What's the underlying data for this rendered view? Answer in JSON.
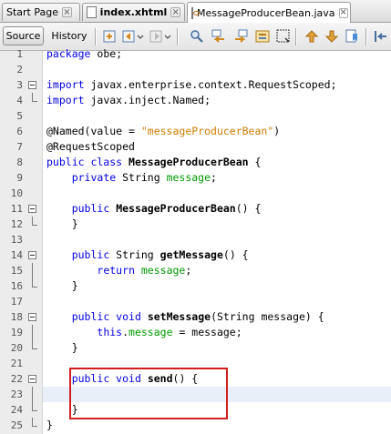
{
  "tabs": [
    {
      "label": "Start Page",
      "active": false,
      "bold": false
    },
    {
      "label": "index.xhtml",
      "active": false,
      "bold": true
    },
    {
      "label": "MessageProducerBean.java",
      "active": true,
      "bold": false
    }
  ],
  "toolbar": {
    "source_label": "Source",
    "history_label": "History",
    "icons": [
      "last-edit-icon",
      "back-icon",
      "forward-icon",
      "find-icon",
      "find-previous-icon",
      "find-next-icon",
      "find-selection-icon",
      "toggle-highlight-icon",
      "toggle-rect-select-icon",
      "previous-bookmark-icon",
      "next-bookmark-icon",
      "toggle-bookmark-icon",
      "shift-left-icon"
    ]
  },
  "editor": {
    "current_line": 23,
    "lines": [
      {
        "n": "1"
      },
      {
        "n": "2"
      },
      {
        "n": "3"
      },
      {
        "n": "4"
      },
      {
        "n": "5"
      },
      {
        "n": "6"
      },
      {
        "n": "7"
      },
      {
        "n": "8"
      },
      {
        "n": "9"
      },
      {
        "n": "10"
      },
      {
        "n": "11"
      },
      {
        "n": "12"
      },
      {
        "n": "13"
      },
      {
        "n": "14"
      },
      {
        "n": "15"
      },
      {
        "n": "16"
      },
      {
        "n": "17"
      },
      {
        "n": "18"
      },
      {
        "n": "19"
      },
      {
        "n": "20"
      },
      {
        "n": "21"
      },
      {
        "n": "22"
      },
      {
        "n": "23"
      },
      {
        "n": "24"
      },
      {
        "n": "25"
      }
    ],
    "code": {
      "l1_kw": "package",
      "l1_rest": " obe;",
      "l3_kw": "import",
      "l3_rest": " javax.enterprise.context.RequestScoped;",
      "l4_kw": "import",
      "l4_rest": " javax.inject.Named;",
      "l6_a": "@Named(value = ",
      "l6_str": "\"messageProducerBean\"",
      "l6_b": ")",
      "l7": "@RequestScoped",
      "l8_kw": "public class",
      "l8_sp": " ",
      "l8_name": "MessageProducerBean",
      "l8_rest": " {",
      "l9_ind": "    ",
      "l9_kw": "private",
      "l9_type": " String ",
      "l9_fld": "message",
      "l9_end": ";",
      "l11_ind": "    ",
      "l11_kw": "public",
      "l11_sp": " ",
      "l11_name": "MessageProducerBean",
      "l11_rest": "() {",
      "l12": "    }",
      "l14_ind": "    ",
      "l14_kw": "public",
      "l14_type": " String ",
      "l14_name": "getMessage",
      "l14_rest": "() {",
      "l15_ind": "        ",
      "l15_kw": "return",
      "l15_sp": " ",
      "l15_fld": "message",
      "l15_end": ";",
      "l16": "    }",
      "l18_ind": "    ",
      "l18_kw": "public void",
      "l18_sp": " ",
      "l18_name": "setMessage",
      "l18_rest": "(String message) {",
      "l19_ind": "        ",
      "l19_kw": "this",
      "l19_dot": ".",
      "l19_fld": "message",
      "l19_rest": " = message;",
      "l20": "    }",
      "l22_ind": "    ",
      "l22_kw": "public void",
      "l22_sp": " ",
      "l22_name": "send",
      "l22_rest": "() {",
      "l24": "    }",
      "l25": "}"
    }
  },
  "colors": {
    "keyword": "#0000e6",
    "field": "#009900",
    "string": "#ce7b00",
    "current_line_bg": "#e9eff8",
    "highlight_box": "#d21e1e"
  }
}
